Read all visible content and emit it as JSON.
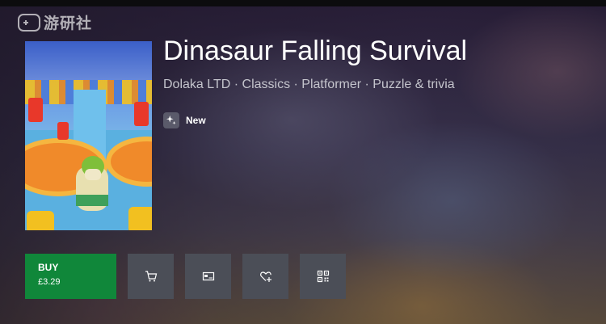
{
  "watermark": {
    "text": "游研社"
  },
  "product": {
    "title": "Dinasaur Falling Survival",
    "meta": "Dolaka LTD · Classics · Platformer · Puzzle & trivia",
    "badge": {
      "icon": "sparkle-icon",
      "label": "New"
    }
  },
  "actions": {
    "buy": {
      "label": "BUY",
      "price": "£3.29",
      "color": "#10873a"
    },
    "icon_buttons": [
      {
        "icon": "cart-icon"
      },
      {
        "icon": "card-icon"
      },
      {
        "icon": "heart-plus-icon"
      },
      {
        "icon": "qr-code-icon"
      }
    ]
  }
}
